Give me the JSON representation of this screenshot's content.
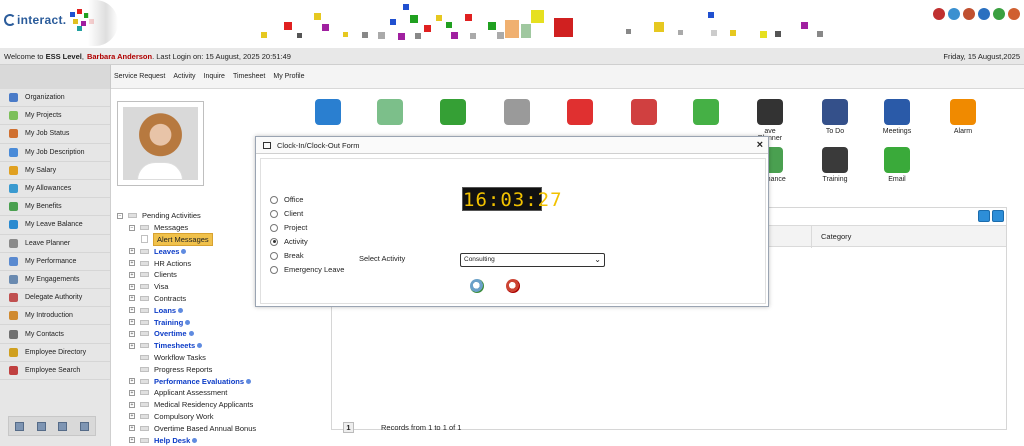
{
  "header": {
    "logo_text": "interact.",
    "logo_dot_colors": [
      "#e02020",
      "#20a020",
      "#2050d0",
      "#e0c020",
      "#a020a0",
      "#20a0a0"
    ],
    "top_icons": [
      "home-icon",
      "save-icon",
      "user-icon",
      "globe-icon",
      "help-icon",
      "logout-icon"
    ]
  },
  "welcome": {
    "prefix": "Welcome to",
    "level": "ESS Level",
    "user": "Barbara Anderson",
    "login_text": ". Last Login on: 15 August, 2025 20:51:49",
    "date": "Friday, 15 August,2025"
  },
  "top_menu": [
    "Service Request",
    "Activity",
    "Inquire",
    "Timesheet",
    "My Profile"
  ],
  "sidebar": {
    "items": [
      {
        "label": "Organization",
        "color": "#4a7bc8"
      },
      {
        "label": "My Projects",
        "color": "#7cbf5a"
      },
      {
        "label": "My Job Status",
        "color": "#d07030"
      },
      {
        "label": "My Job Description",
        "color": "#4a8bd8"
      },
      {
        "label": "My Salary",
        "color": "#e0a020"
      },
      {
        "label": "My Allowances",
        "color": "#3a9ad0"
      },
      {
        "label": "My Benefits",
        "color": "#4aa050"
      },
      {
        "label": "My Leave Balance",
        "color": "#2a8ad0"
      },
      {
        "label": "Leave Planner",
        "color": "#8a8a8a"
      },
      {
        "label": "My Performance",
        "color": "#5a8ad0"
      },
      {
        "label": "My Engagements",
        "color": "#6a8ab0"
      },
      {
        "label": "Delegate Authority",
        "color": "#c05050"
      },
      {
        "label": "My Introduction",
        "color": "#d08a30"
      },
      {
        "label": "My Contacts",
        "color": "#707070"
      },
      {
        "label": "Employee Directory",
        "color": "#d0a020"
      },
      {
        "label": "Employee Search",
        "color": "#c04040"
      }
    ]
  },
  "quick_icons": [
    {
      "label": "",
      "color": "#2a7fd0"
    },
    {
      "label": "",
      "color": "#7cbf8a"
    },
    {
      "label": "",
      "color": "#35a035"
    },
    {
      "label": "",
      "color": "#9a9a9a"
    },
    {
      "label": "",
      "color": "#e03030"
    },
    {
      "label": "",
      "color": "#d04040"
    },
    {
      "label": "",
      "color": "#45b045"
    },
    {
      "label": "ave Planner",
      "color": "#333333"
    },
    {
      "label": "To Do",
      "color": "#34508a"
    },
    {
      "label": "Meetings",
      "color": "#2a5aa8"
    },
    {
      "label": "Alarm",
      "color": "#f08a00"
    },
    {
      "label": "rformance",
      "color": "#4aa050"
    },
    {
      "label": "Training",
      "color": "#3a3a3a"
    },
    {
      "label": "Email",
      "color": "#3aaa3a"
    }
  ],
  "tree": [
    {
      "label": "Pending Activities",
      "indent": 0,
      "bold": false,
      "pm": "−"
    },
    {
      "label": "Messages",
      "indent": 1,
      "bold": false,
      "pm": "−"
    },
    {
      "label": "Alert Messages",
      "indent": 2,
      "bold": false,
      "alert": true
    },
    {
      "label": "Leaves",
      "indent": 1,
      "bold": true,
      "pm": "+",
      "dot": true
    },
    {
      "label": "HR Actions",
      "indent": 1,
      "bold": false,
      "pm": "+"
    },
    {
      "label": "Clients",
      "indent": 1,
      "bold": false,
      "pm": "+"
    },
    {
      "label": "Visa",
      "indent": 1,
      "bold": false,
      "pm": "+"
    },
    {
      "label": "Contracts",
      "indent": 1,
      "bold": false,
      "pm": "+"
    },
    {
      "label": "Loans",
      "indent": 1,
      "bold": true,
      "pm": "+",
      "dot": true
    },
    {
      "label": "Training",
      "indent": 1,
      "bold": true,
      "pm": "+",
      "dot": true
    },
    {
      "label": "Overtime",
      "indent": 1,
      "bold": true,
      "pm": "+",
      "dot": true
    },
    {
      "label": "Timesheets",
      "indent": 1,
      "bold": true,
      "pm": "+",
      "dot": true
    },
    {
      "label": "Workflow Tasks",
      "indent": 1,
      "bold": false,
      "pm": ""
    },
    {
      "label": "Progress Reports",
      "indent": 1,
      "bold": false,
      "pm": ""
    },
    {
      "label": "Performance Evaluations",
      "indent": 1,
      "bold": true,
      "pm": "+",
      "dot": true
    },
    {
      "label": "Applicant Assessment",
      "indent": 1,
      "bold": false,
      "pm": "+"
    },
    {
      "label": "Medical Residency Applicants",
      "indent": 1,
      "bold": false,
      "pm": "+"
    },
    {
      "label": "Compulsory Work",
      "indent": 1,
      "bold": false,
      "pm": "+"
    },
    {
      "label": "Overtime Based Annual Bonus",
      "indent": 1,
      "bold": false,
      "pm": "+"
    },
    {
      "label": "Help Desk",
      "indent": 1,
      "bold": true,
      "pm": "+",
      "dot": true
    }
  ],
  "grid": {
    "column_category": "Category",
    "page": "1",
    "records_text": "Records from 1 to 1 of 1"
  },
  "modal": {
    "title": "Clock-In/Clock-Out Form",
    "close": "×",
    "clock": "16:03:27",
    "options": [
      {
        "label": "Office",
        "checked": false
      },
      {
        "label": "Client",
        "checked": false
      },
      {
        "label": "Project",
        "checked": false
      },
      {
        "label": "Activity",
        "checked": true
      },
      {
        "label": "Break",
        "checked": false
      },
      {
        "label": "Emergency Leave",
        "checked": false
      }
    ],
    "select_label": "Select Activity",
    "select_value": "Consulting"
  }
}
